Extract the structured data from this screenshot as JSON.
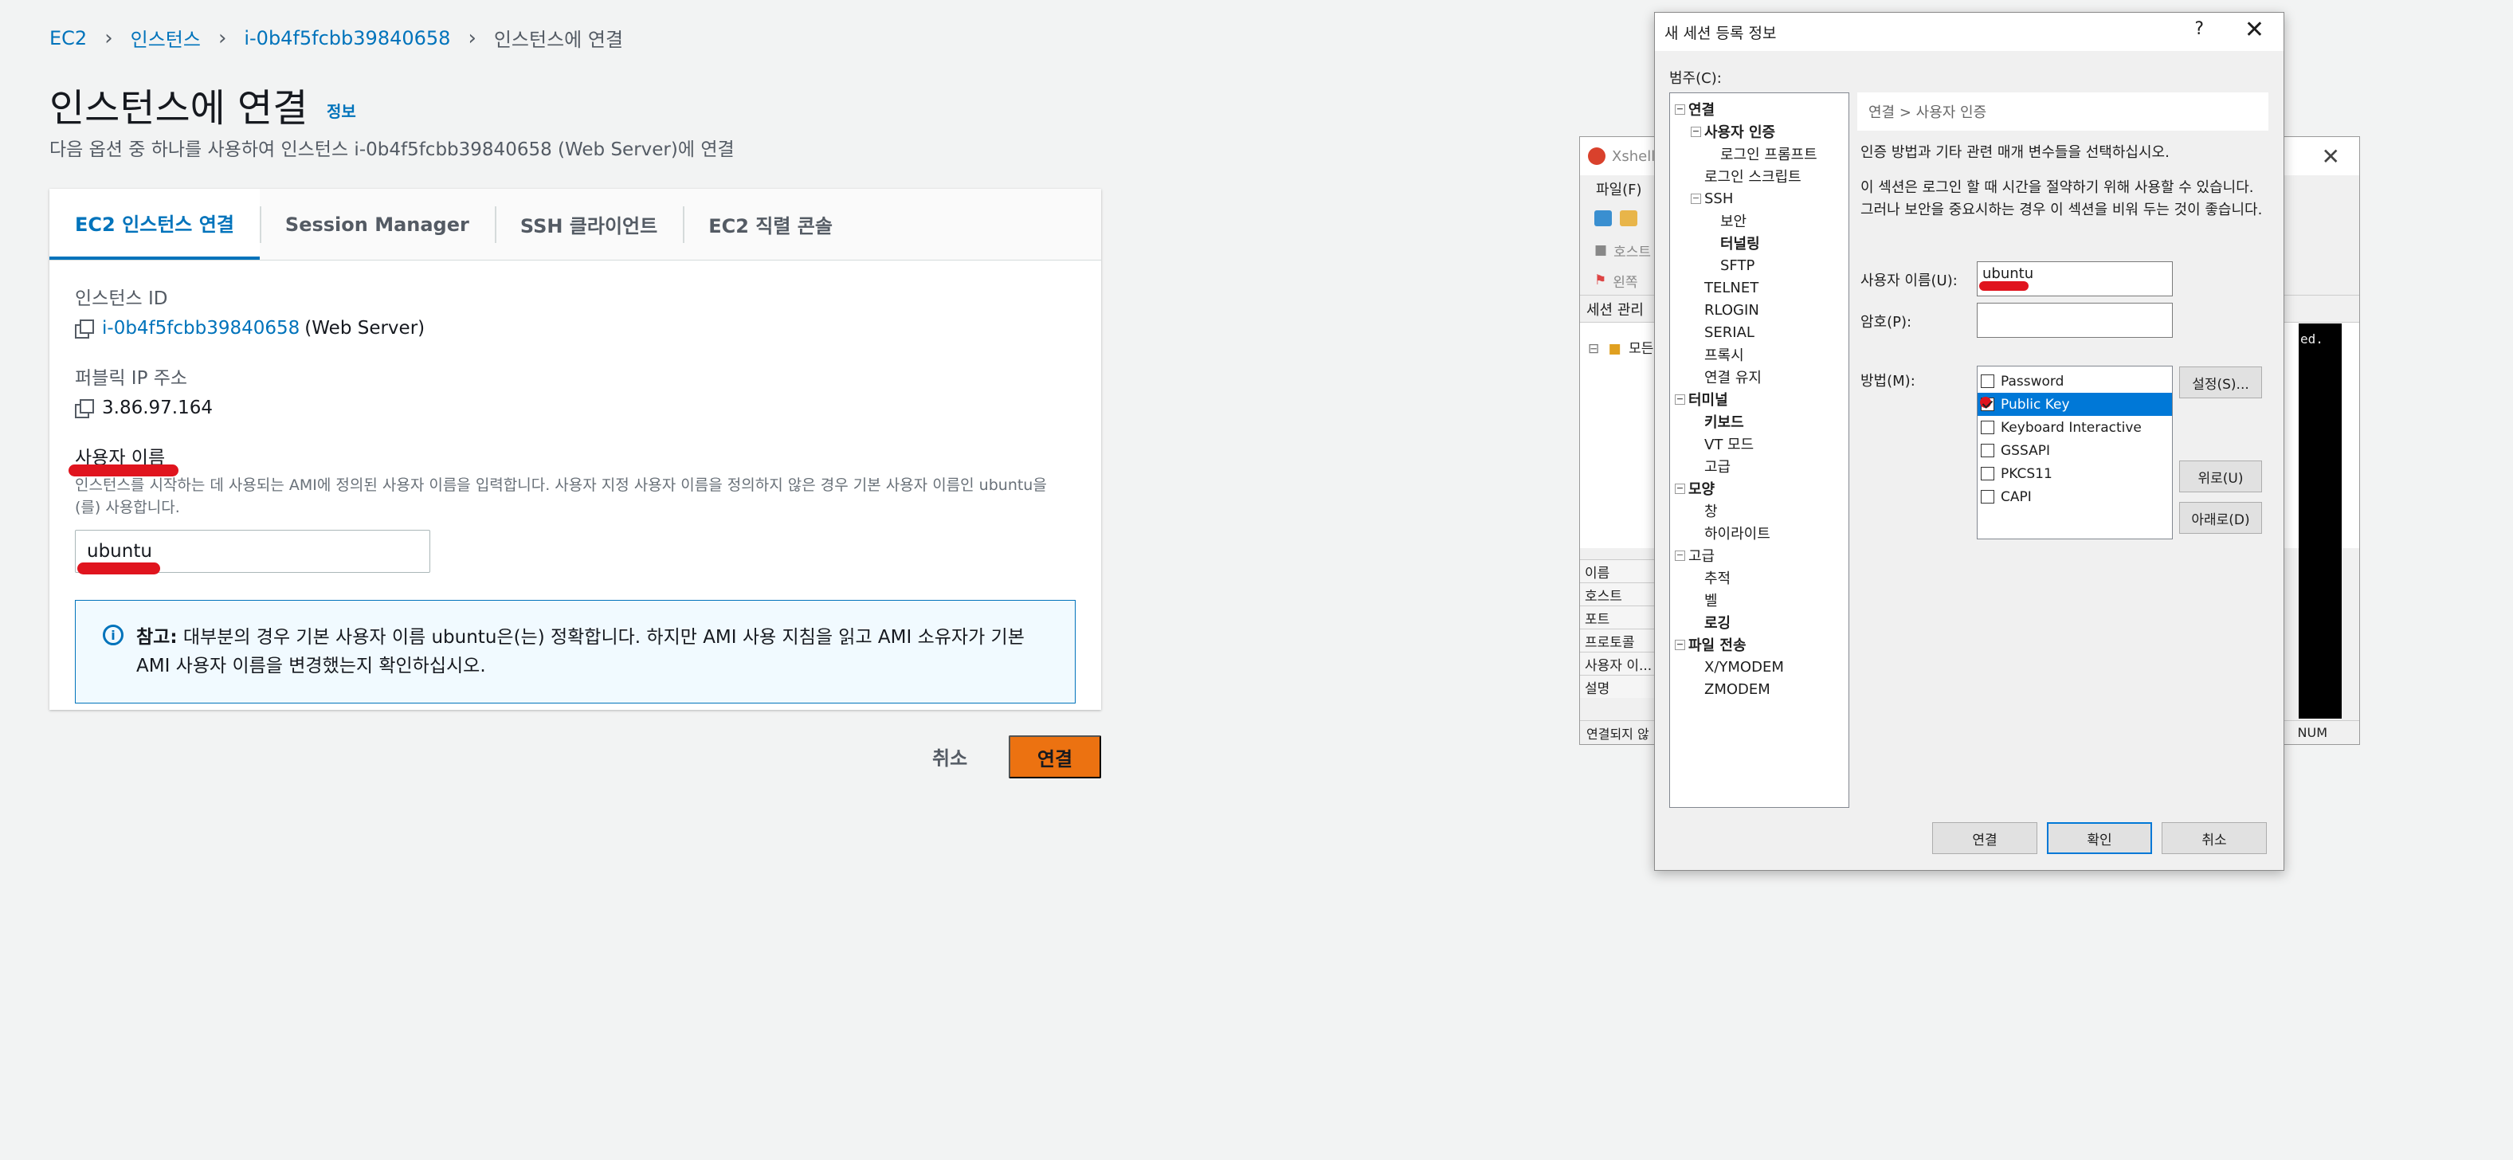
{
  "breadcrumb": {
    "items": [
      "EC2",
      "인스턴스",
      "i-0b4f5fcbb39840658"
    ],
    "current": "인스턴스에 연결"
  },
  "page": {
    "title": "인스턴스에 연결",
    "info_link": "정보",
    "description": "다음 옵션 중 하나를 사용하여 인스턴스 i-0b4f5fcbb39840658 (Web Server)에 연결"
  },
  "tabs": [
    "EC2 인스턴스 연결",
    "Session Manager",
    "SSH 클라이언트",
    "EC2 직렬 콘솔"
  ],
  "instance": {
    "id_label": "인스턴스 ID",
    "id": "i-0b4f5fcbb39840658",
    "name_suffix": "(Web Server)",
    "ip_label": "퍼블릭 IP 주소",
    "ip": "3.86.97.164"
  },
  "username": {
    "label": "사용자 이름",
    "hint": "인스턴스를 시작하는 데 사용되는 AMI에 정의된 사용자 이름을 입력합니다. 사용자 지정 사용자 이름을 정의하지 않은 경우 기본 사용자 이름인 ubuntu을(를) 사용합니다.",
    "value": "ubuntu"
  },
  "note": {
    "prefix": "참고:",
    "text": "대부분의 경우 기본 사용자 이름 ubuntu은(는) 정확합니다. 하지만 AMI 사용 지침을 읽고 AMI 소유자가 기본 AMI 사용자 이름을 변경했는지 확인하십시오."
  },
  "actions": {
    "cancel": "취소",
    "connect": "연결"
  },
  "xshell": {
    "title": "Xshell",
    "menu": "파일(F)",
    "addr": "호스트",
    "addr2": "왼쪽",
    "session_title": "세션 관리",
    "tree_item": "모든",
    "props": [
      "이름",
      "호스트",
      "포트",
      "프로토콜",
      "사용자 이...",
      "설명"
    ],
    "terminal_text": "ed.",
    "status": "연결되지 않",
    "num": "NUM"
  },
  "dialog": {
    "title": "새 세션 등록 정보",
    "help": "?",
    "category_label": "범주(C):",
    "tree": [
      {
        "label": "연결",
        "level": 0,
        "bold": true,
        "box": "⊟"
      },
      {
        "label": "사용자 인증",
        "level": 1,
        "bold": true,
        "box": "⊟"
      },
      {
        "label": "로그인 프롬프트",
        "level": 2,
        "bold": false,
        "box": ""
      },
      {
        "label": "로그인 스크립트",
        "level": 1,
        "bold": false,
        "box": ""
      },
      {
        "label": "SSH",
        "level": 1,
        "bold": false,
        "box": "⊟"
      },
      {
        "label": "보안",
        "level": 2,
        "bold": false,
        "box": ""
      },
      {
        "label": "터널링",
        "level": 2,
        "bold": true,
        "box": ""
      },
      {
        "label": "SFTP",
        "level": 2,
        "bold": false,
        "box": ""
      },
      {
        "label": "TELNET",
        "level": 1,
        "bold": false,
        "box": ""
      },
      {
        "label": "RLOGIN",
        "level": 1,
        "bold": false,
        "box": ""
      },
      {
        "label": "SERIAL",
        "level": 1,
        "bold": false,
        "box": ""
      },
      {
        "label": "프록시",
        "level": 1,
        "bold": false,
        "box": ""
      },
      {
        "label": "연결 유지",
        "level": 1,
        "bold": false,
        "box": ""
      },
      {
        "label": "터미널",
        "level": 0,
        "bold": true,
        "box": "⊟"
      },
      {
        "label": "키보드",
        "level": 1,
        "bold": true,
        "box": ""
      },
      {
        "label": "VT 모드",
        "level": 1,
        "bold": false,
        "box": ""
      },
      {
        "label": "고급",
        "level": 1,
        "bold": false,
        "box": ""
      },
      {
        "label": "모양",
        "level": 0,
        "bold": true,
        "box": "⊟"
      },
      {
        "label": "창",
        "level": 1,
        "bold": false,
        "box": ""
      },
      {
        "label": "하이라이트",
        "level": 1,
        "bold": false,
        "box": ""
      },
      {
        "label": "고급",
        "level": 0,
        "bold": false,
        "box": "⊟"
      },
      {
        "label": "추적",
        "level": 1,
        "bold": false,
        "box": ""
      },
      {
        "label": "벨",
        "level": 1,
        "bold": false,
        "box": ""
      },
      {
        "label": "로깅",
        "level": 1,
        "bold": true,
        "box": ""
      },
      {
        "label": "파일 전송",
        "level": 0,
        "bold": true,
        "box": "⊟"
      },
      {
        "label": "X/YMODEM",
        "level": 1,
        "bold": false,
        "box": ""
      },
      {
        "label": "ZMODEM",
        "level": 1,
        "bold": false,
        "box": ""
      }
    ],
    "crumb": "연결 > 사용자 인증",
    "desc1": "인증 방법과 기타 관련 매개 변수들을 선택하십시오.",
    "desc2": "이 섹션은 로그인 할 때 시간을 절약하기 위해 사용할 수 있습니다. 그러나 보안을 중요시하는 경우 이 섹션을 비워 두는 것이 좋습니다.",
    "username_label": "사용자 이름(U):",
    "username_value": "ubuntu",
    "password_label": "암호(P):",
    "method_label": "방법(M):",
    "methods": [
      {
        "label": "Password",
        "checked": false,
        "selected": false
      },
      {
        "label": "Public Key",
        "checked": true,
        "selected": true
      },
      {
        "label": "Keyboard Interactive",
        "checked": false,
        "selected": false
      },
      {
        "label": "GSSAPI",
        "checked": false,
        "selected": false
      },
      {
        "label": "PKCS11",
        "checked": false,
        "selected": false
      },
      {
        "label": "CAPI",
        "checked": false,
        "selected": false
      }
    ],
    "settings_btn": "설정(S)...",
    "up_btn": "위로(U)",
    "down_btn": "아래로(D)",
    "connect_btn": "연결",
    "ok_btn": "확인",
    "cancel_btn": "취소"
  },
  "colors": {
    "aws_link": "#0073bb",
    "aws_orange": "#ec7211",
    "win_select": "#0078d7",
    "annotation_red": "#e0141e"
  }
}
